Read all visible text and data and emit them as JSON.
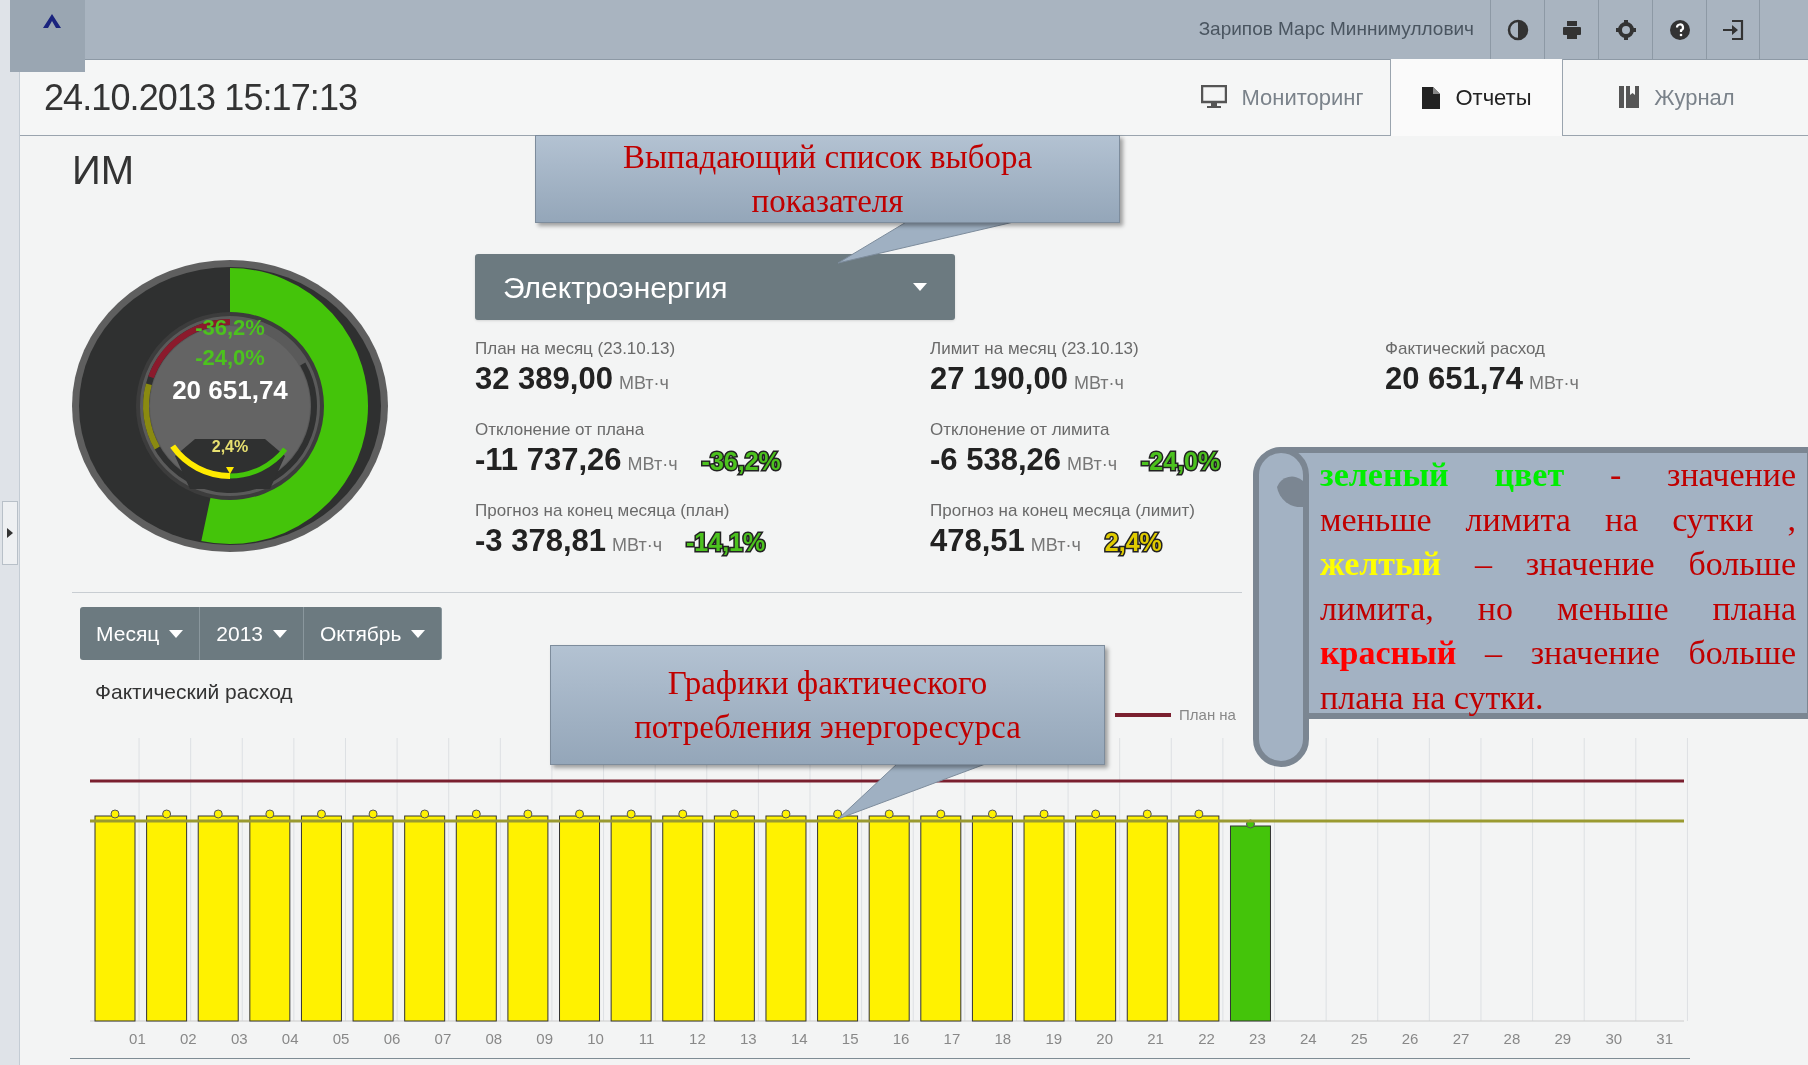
{
  "header": {
    "user": "Зарипов Марс Миннимуллович"
  },
  "datetime": "24.10.2013 15:17:13",
  "tabs": [
    {
      "label": "Мониторинг",
      "kind": "monitor",
      "selected": false
    },
    {
      "label": "Отчеты",
      "kind": "document",
      "selected": true
    },
    {
      "label": "Журнал",
      "kind": "book",
      "selected": false
    }
  ],
  "title": "ИМ",
  "gauge": {
    "plan_deviation": "-36,2%",
    "limit_deviation": "-24,0%",
    "value": "20 651,74",
    "forecast": "2,4%"
  },
  "indicator_select": {
    "value": "Электроэнергия"
  },
  "stat_columns": [
    [
      {
        "label": "План на месяц (23.10.13)",
        "value": "32 389,00",
        "unit": "МВт·ч"
      },
      {
        "label": "Отклонение от плана",
        "value": "-11 737,26",
        "unit": "МВт·ч",
        "change": "-36,2%",
        "color": "#4cc21e"
      },
      {
        "label": "Прогноз на конец месяца (план)",
        "value": "-3 378,81",
        "unit": "МВт·ч",
        "change": "-14,1%",
        "color": "#4cc21e"
      }
    ],
    [
      {
        "label": "Лимит на месяц (23.10.13)",
        "value": "27 190,00",
        "unit": "МВт·ч"
      },
      {
        "label": "Отклонение от лимита",
        "value": "-6 538,26",
        "unit": "МВт·ч",
        "change": "-24,0%",
        "color": "#4cc21e"
      },
      {
        "label": "Прогноз на конец месяца (лимит)",
        "value": "478,51",
        "unit": "МВт·ч",
        "change": "2,4%",
        "color": "#e0cc00"
      }
    ],
    [
      {
        "label": "Фактический расход",
        "value": "20 651,74",
        "unit": "МВт·ч"
      }
    ]
  ],
  "period": [
    {
      "label": "Месяц"
    },
    {
      "label": "2013"
    },
    {
      "label": "Октябрь"
    }
  ],
  "chart": {
    "title": "Фактический расход",
    "legend": "План на",
    "days": [
      {
        "label": "01",
        "color": "#fff200"
      },
      {
        "label": "02",
        "color": "#fff200"
      },
      {
        "label": "03",
        "color": "#fff200"
      },
      {
        "label": "04",
        "color": "#fff200"
      },
      {
        "label": "05",
        "color": "#fff200"
      },
      {
        "label": "06",
        "color": "#fff200"
      },
      {
        "label": "07",
        "color": "#fff200"
      },
      {
        "label": "08",
        "color": "#fff200"
      },
      {
        "label": "09",
        "color": "#fff200"
      },
      {
        "label": "10",
        "color": "#fff200"
      },
      {
        "label": "11",
        "color": "#fff200"
      },
      {
        "label": "12",
        "color": "#fff200"
      },
      {
        "label": "13",
        "color": "#fff200"
      },
      {
        "label": "14",
        "color": "#fff200"
      },
      {
        "label": "15",
        "color": "#fff200"
      },
      {
        "label": "16",
        "color": "#fff200"
      },
      {
        "label": "17",
        "color": "#fff200"
      },
      {
        "label": "18",
        "color": "#fff200"
      },
      {
        "label": "19",
        "color": "#fff200"
      },
      {
        "label": "20",
        "color": "#fff200"
      },
      {
        "label": "21",
        "color": "#fff200"
      },
      {
        "label": "22",
        "color": "#fff200"
      },
      {
        "label": "23",
        "color": "#44c40a"
      },
      {
        "label": "24"
      },
      {
        "label": "25"
      },
      {
        "label": "26"
      },
      {
        "label": "27"
      },
      {
        "label": "28"
      },
      {
        "label": "29"
      },
      {
        "label": "30"
      },
      {
        "label": "31"
      }
    ]
  },
  "annotations": [
    {
      "text": "Выпадающий список выбора показателя"
    },
    {
      "text": "Графики фактического потребления энергоресурса"
    }
  ],
  "color_note": [
    {
      "text": "зеленый цвет",
      "kind": "green"
    },
    {
      "text": " - значение меньше лимита на сутки , ",
      "kind": "plain"
    },
    {
      "text": "желтый",
      "kind": "yellow"
    },
    {
      "text": " – значение больше лимита, но меньше плана ",
      "kind": "plain"
    },
    {
      "text": "красный",
      "kind": "red"
    },
    {
      "text": " – значение больше плана  на сутки.",
      "kind": "plain"
    }
  ]
}
